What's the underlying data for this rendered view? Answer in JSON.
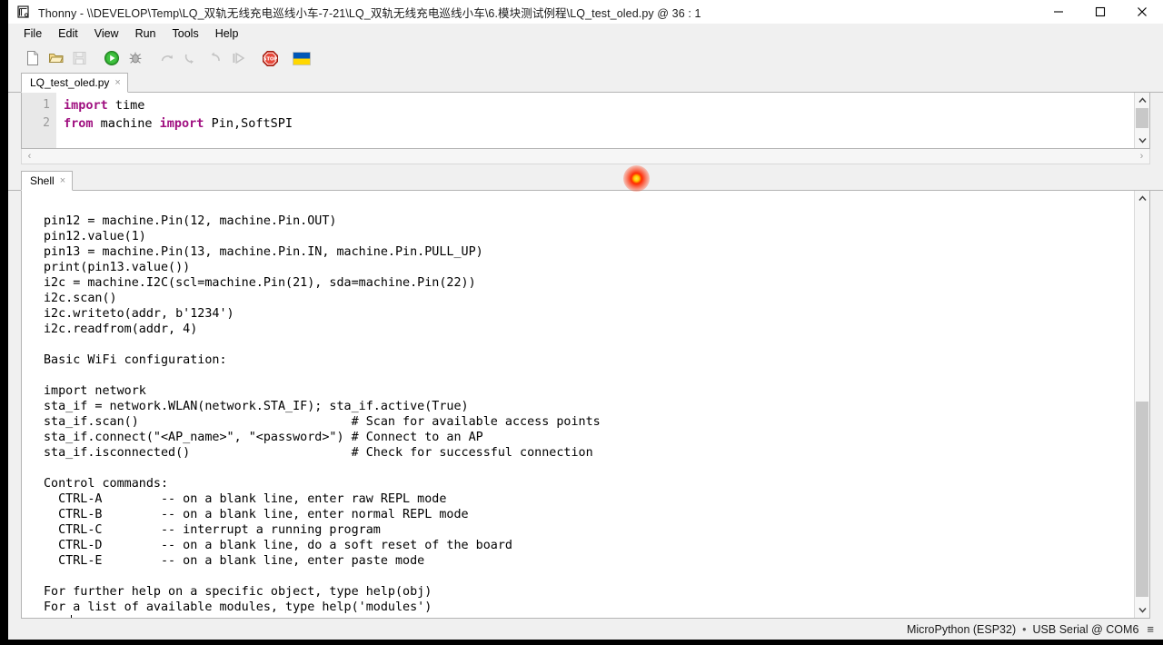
{
  "window": {
    "title": "Thonny  -  \\\\DEVELOP\\Temp\\LQ_双轨无线充电巡线小车-7-21\\LQ_双轨无线充电巡线小车\\6.模块测试例程\\LQ_test_oled.py  @  36 : 1",
    "app_icon": "thonny-icon",
    "minimize_label": "minimize",
    "maximize_label": "maximize",
    "close_label": "close"
  },
  "menubar": {
    "items": [
      {
        "label": "File"
      },
      {
        "label": "Edit"
      },
      {
        "label": "View"
      },
      {
        "label": "Run"
      },
      {
        "label": "Tools"
      },
      {
        "label": "Help"
      }
    ]
  },
  "toolbar": {
    "buttons": [
      {
        "name": "new-file-icon",
        "title": "New",
        "enabled": true
      },
      {
        "name": "open-file-icon",
        "title": "Load",
        "enabled": true
      },
      {
        "name": "save-file-icon",
        "title": "Save",
        "enabled": false
      },
      {
        "name": "run-current-script-icon",
        "title": "Run current script",
        "enabled": true
      },
      {
        "name": "debug-current-script-icon",
        "title": "Debug current script",
        "enabled": true
      },
      {
        "name": "step-over-icon",
        "title": "Step over",
        "enabled": false
      },
      {
        "name": "step-into-icon",
        "title": "Step into",
        "enabled": false
      },
      {
        "name": "step-out-icon",
        "title": "Step out",
        "enabled": false
      },
      {
        "name": "resume-icon",
        "title": "Resume",
        "enabled": false
      },
      {
        "name": "stop-icon",
        "title": "Stop/Restart backend",
        "enabled": true
      },
      {
        "name": "ukraine-flag-icon",
        "title": "Support Ukraine",
        "enabled": true
      }
    ]
  },
  "editor": {
    "tab": {
      "label": "LQ_test_oled.py",
      "close_glyph": "×"
    },
    "lines": [
      {
        "no": "1",
        "tokens": [
          {
            "t": "import",
            "k": true
          },
          {
            "t": " time",
            "k": false
          }
        ]
      },
      {
        "no": "2",
        "tokens": [
          {
            "t": "from",
            "k": true
          },
          {
            "t": " machine ",
            "k": false
          },
          {
            "t": "import",
            "k": true
          },
          {
            "t": " Pin,SoftSPI",
            "k": false
          }
        ]
      }
    ],
    "hscroll": {
      "left_glyph": "‹",
      "right_glyph": "›"
    },
    "vscroll": {
      "up_glyph": "⌃",
      "down_glyph": "⌄"
    }
  },
  "shell": {
    "tab": {
      "label": "Shell",
      "close_glyph": "×"
    },
    "content": "pin12 = machine.Pin(12, machine.Pin.OUT)\npin12.value(1)\npin13 = machine.Pin(13, machine.Pin.IN, machine.Pin.PULL_UP)\nprint(pin13.value())\ni2c = machine.I2C(scl=machine.Pin(21), sda=machine.Pin(22))\ni2c.scan()\ni2c.writeto(addr, b'1234')\ni2c.readfrom(addr, 4)\n\nBasic WiFi configuration:\n\nimport network\nsta_if = network.WLAN(network.STA_IF); sta_if.active(True)\nsta_if.scan()                             # Scan for available access points\nsta_if.connect(\"<AP_name>\", \"<password>\") # Connect to an AP\nsta_if.isconnected()                      # Check for successful connection\n\nControl commands:\n  CTRL-A        -- on a blank line, enter raw REPL mode\n  CTRL-B        -- on a blank line, enter normal REPL mode\n  CTRL-C        -- interrupt a running program\n  CTRL-D        -- on a blank line, do a soft reset of the board\n  CTRL-E        -- on a blank line, enter paste mode\n\nFor further help on a specific object, type help(obj)\nFor a list of available modules, type help('modules')\n",
    "prompt": ">>>",
    "vscroll": {
      "up_glyph": "⌃",
      "down_glyph": "⌄"
    }
  },
  "statusbar": {
    "interpreter": "MicroPython (ESP32)",
    "separator": "•",
    "connection": "USB Serial @ COM6",
    "menu_glyph": "≡"
  },
  "overlay": {
    "click_marker": "mouse-click-indicator"
  },
  "colors": {
    "keyword": "#a01080",
    "prompt": "#8b1a8b",
    "chrome": "#f0f0f0",
    "pane": "#ffffff",
    "border": "#b4b4b4",
    "gutter": "#e8e8e8",
    "accent_stop": "#cc2222",
    "flag_blue": "#0057b7",
    "flag_yellow": "#ffd700"
  }
}
